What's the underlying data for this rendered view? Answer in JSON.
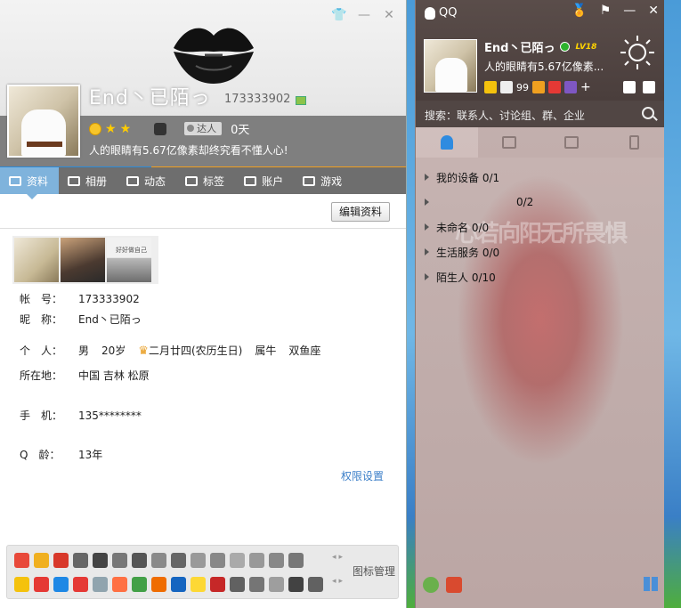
{
  "profile": {
    "name": "End丶已陌っ",
    "qq_number": "173333902",
    "talent_label": "达人",
    "days": "0天",
    "signature": "人的眼睛有5.67亿像素却终究看不懂人心!",
    "tabs": [
      {
        "label": "资料",
        "icon": "profile-card-icon"
      },
      {
        "label": "相册",
        "icon": "album-icon"
      },
      {
        "label": "动态",
        "icon": "feed-icon"
      },
      {
        "label": "标签",
        "icon": "tag-icon"
      },
      {
        "label": "账户",
        "icon": "wallet-icon"
      },
      {
        "label": "游戏",
        "icon": "game-icon"
      }
    ],
    "edit_button": "编辑资料",
    "photo_caption": "好好做自己",
    "info": {
      "account_label": "帐　号：",
      "account": "173333902",
      "nick_label": "昵　称：",
      "nick": "End丶已陌っ",
      "personal_label": "个　人：",
      "gender": "男",
      "age": "20岁",
      "birthday": "二月廿四(农历生日)",
      "zodiac": "属牛",
      "star_sign": "双鱼座",
      "location_label": "所在地：",
      "location": "中国 吉林 松原",
      "phone_label": "手　机：",
      "phone": "135********",
      "qage_label": "Q　龄：",
      "qage": "13年"
    },
    "permissions_link": "权限设置",
    "icon_manager": "图标管理"
  },
  "qq": {
    "title": "QQ",
    "name": "End丶已陌っ",
    "level_badge": "LV18",
    "signature": "人的眼睛有5.67亿像素...",
    "mail_count": "99",
    "search_placeholder": "搜索：联系人、讨论组、群、企业",
    "groups": [
      {
        "label": "我的设备 0/1"
      },
      {
        "label": "0/2"
      },
      {
        "label": "未命名 0/0"
      },
      {
        "label": "生活服务 0/0"
      },
      {
        "label": "陌生人 0/10"
      }
    ],
    "bg_text": "心若向阳无所畏惧"
  },
  "colors": {
    "tab_active": "#7fb3dc",
    "header_band": "#7f7f7f",
    "link": "#3a7ec8",
    "qq_header": "#4a3e3c"
  }
}
